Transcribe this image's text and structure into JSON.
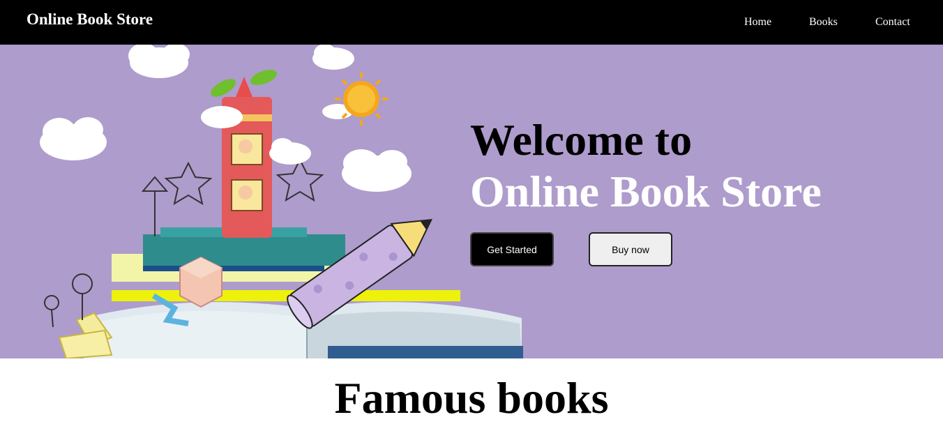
{
  "navbar": {
    "brand": "Online Book Store",
    "links": [
      "Home",
      "Books",
      "Contact"
    ]
  },
  "hero": {
    "line1": "Welcome to",
    "line2": "Online Book Store",
    "primary_button": "Get Started",
    "secondary_button": "Buy now"
  },
  "section": {
    "title": "Famous books"
  },
  "colors": {
    "navbar_bg": "#000000",
    "hero_bg": "#ae9ccc",
    "primary_button_bg": "#000000",
    "secondary_button_bg": "#efefef"
  },
  "hero_illustration": "children's book illustration with open book, red pencil tower with kids, clouds, sun, blocks, stars"
}
